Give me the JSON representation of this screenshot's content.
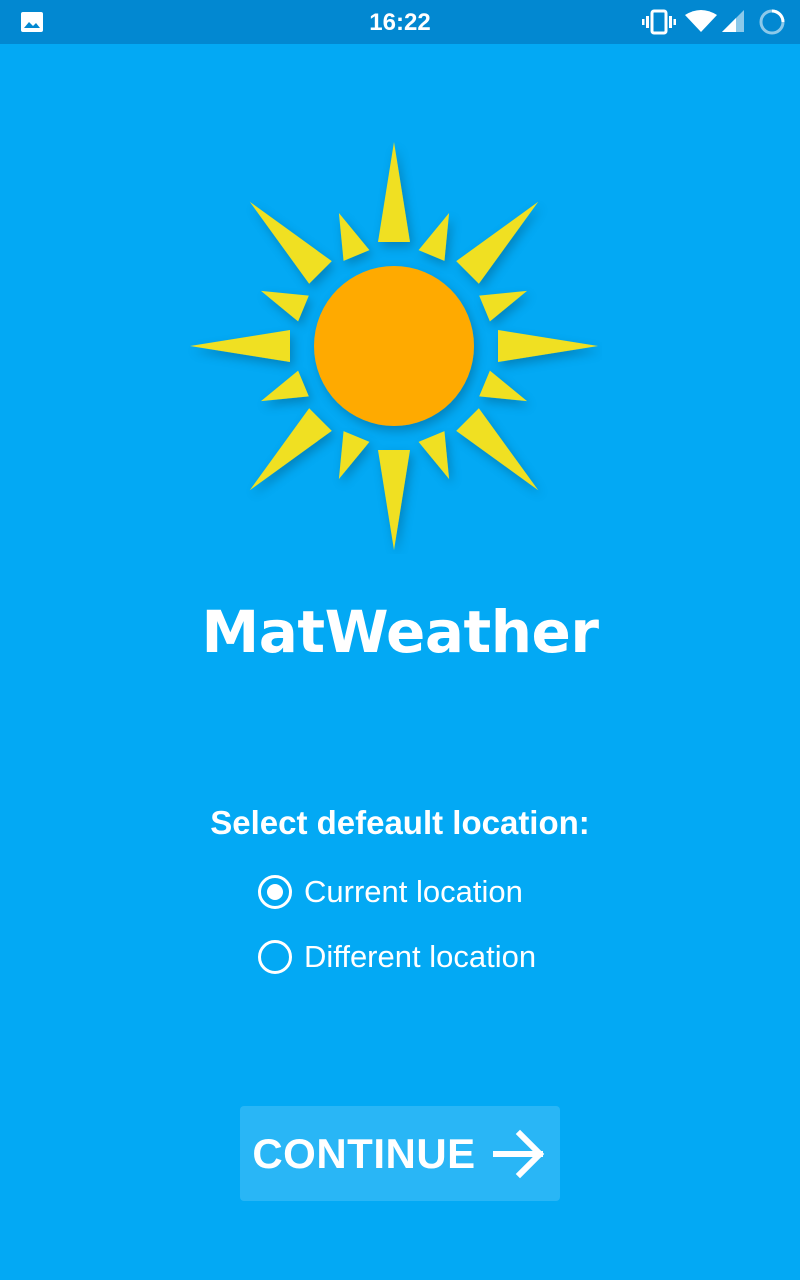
{
  "status_bar": {
    "time": "16:22",
    "icons": [
      "gallery-icon",
      "vibrate-icon",
      "wifi-icon",
      "signal-icon",
      "sync-icon"
    ]
  },
  "app": {
    "logo": "sun-icon",
    "title": "MatWeather"
  },
  "location_select": {
    "prompt": "Select defeault location:",
    "options": [
      {
        "label": "Current location",
        "selected": true
      },
      {
        "label": "Different location",
        "selected": false
      }
    ]
  },
  "continue_button": {
    "label": "CONTINUE",
    "icon": "arrow-right-icon"
  },
  "colors": {
    "background": "#03A9F4",
    "status_bar": "#0288D1",
    "button": "#29B6F6",
    "sun_core": "#FFAA00",
    "sun_rays": "#F0E020"
  }
}
